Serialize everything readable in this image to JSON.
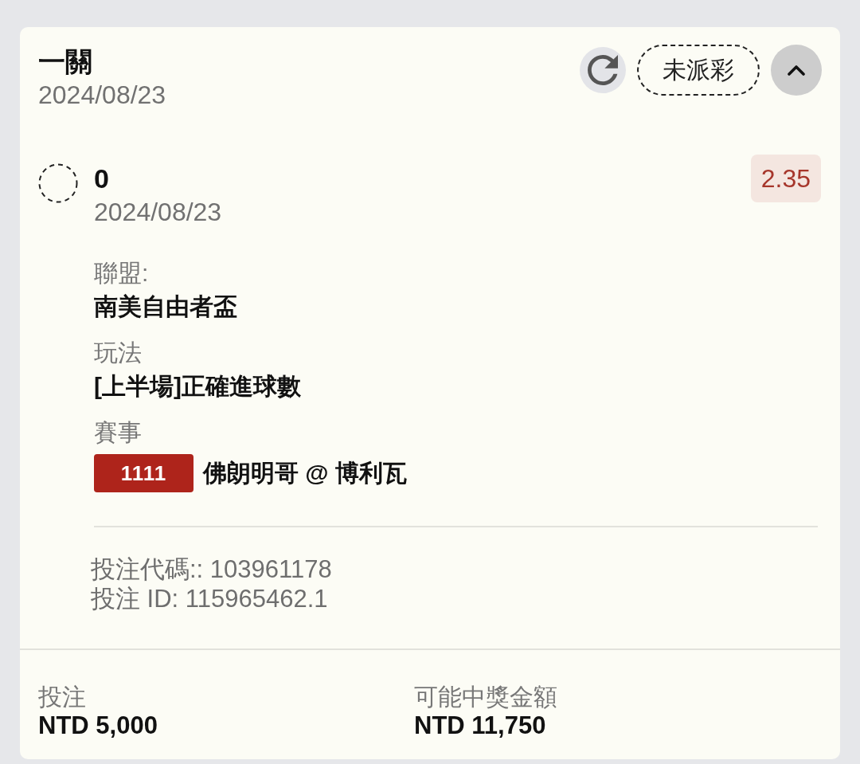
{
  "bet": {
    "title": "一關",
    "date": "2024/08/23",
    "status": "未派彩",
    "expanded": true
  },
  "selection": {
    "pick": "0",
    "date": "2024/08/23",
    "odds": "2.35"
  },
  "details": [
    {
      "kind": "text",
      "label": "聯盟:",
      "value": "南美自由者盃"
    },
    {
      "kind": "text",
      "label": "玩法",
      "value": "[上半場]正確進球數"
    },
    {
      "kind": "match",
      "label": "賽事",
      "badge": "1111",
      "value": "佛朗明哥 @ 博利瓦"
    }
  ],
  "codes": [
    "投注代碼:: 103961178",
    "投注 ID: 115965462.1"
  ],
  "summary": [
    {
      "label": "投注",
      "value": "NTD 5,000"
    },
    {
      "label": "可能中獎金額",
      "value": "NTD 11,750"
    }
  ]
}
